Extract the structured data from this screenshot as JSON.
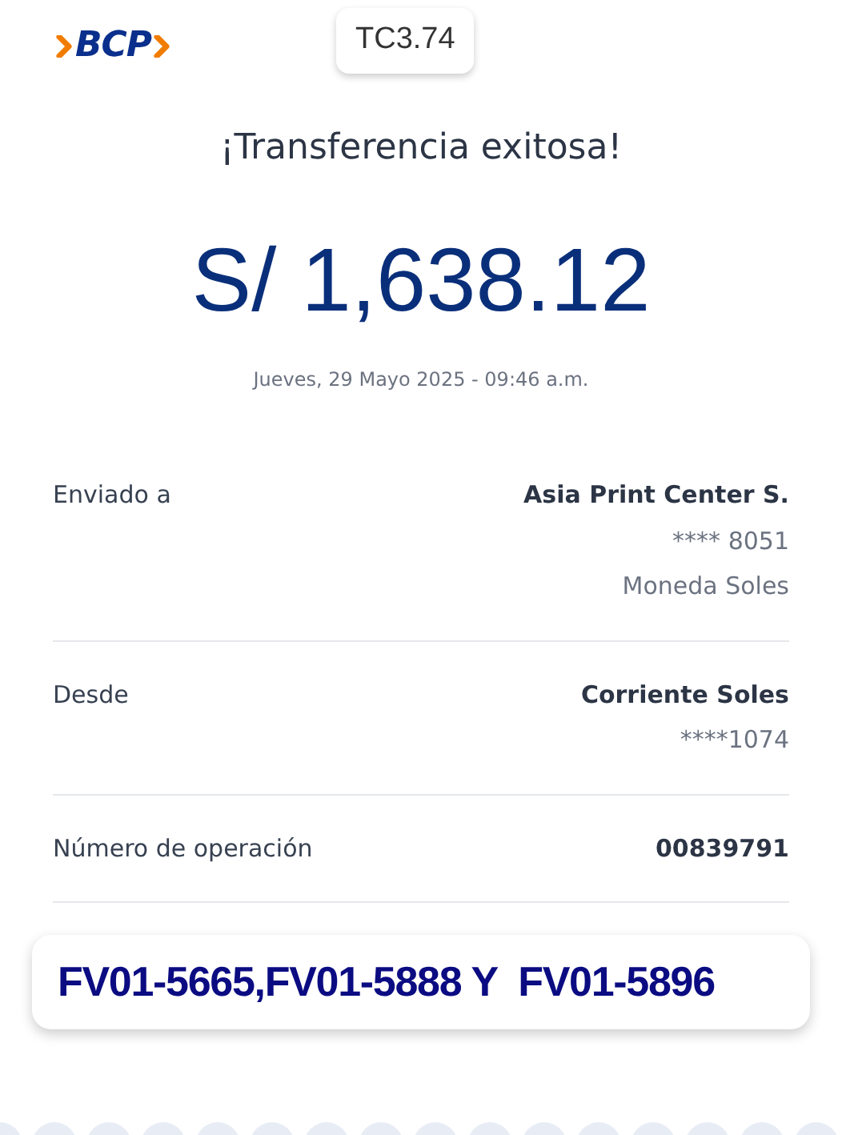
{
  "logo": {
    "text": "BCP"
  },
  "exchange_badge": "TC3.74",
  "title": "¡Transferencia exitosa!",
  "amount": "S/ 1,638.12",
  "date": "Jueves, 29 Mayo 2025 - 09:46 a.m.",
  "details": [
    {
      "label": "Enviado a",
      "values": [
        "Asia Print Center S.",
        "**** 8051",
        "Moneda Soles"
      ]
    },
    {
      "label": "Desde",
      "values": [
        "Corriente Soles",
        "****1074"
      ]
    },
    {
      "label": "Número de operación",
      "values": [
        "00839791"
      ]
    }
  ],
  "note": "FV01-5665,FV01-5888 Y  FV01-5896"
}
